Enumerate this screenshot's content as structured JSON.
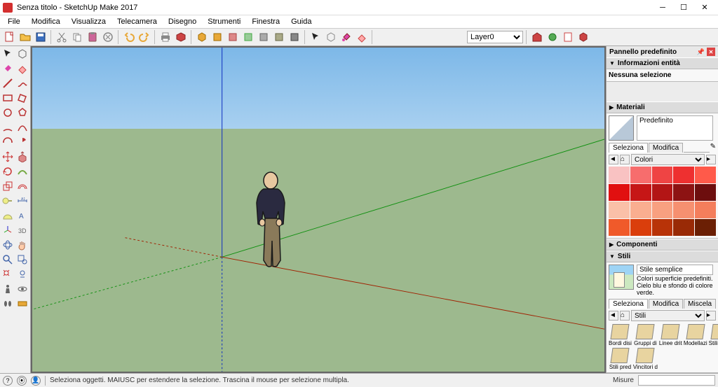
{
  "window": {
    "title": "Senza titolo - SketchUp Make 2017"
  },
  "menu": [
    "File",
    "Modifica",
    "Visualizza",
    "Telecamera",
    "Disegno",
    "Strumenti",
    "Finestra",
    "Guida"
  ],
  "layer": {
    "current": "Layer0"
  },
  "tray": {
    "title": "Pannello predefinito",
    "entity": {
      "header": "Informazioni entità",
      "body": "Nessuna selezione"
    },
    "materials": {
      "header": "Materiali",
      "current_name": "Predefinito",
      "tabs": [
        "Seleziona",
        "Modifica"
      ],
      "library": "Colori",
      "swatches": [
        "#f9c2c2",
        "#f76d6d",
        "#ef4444",
        "#ee3030",
        "#ff5a4a",
        "#e11010",
        "#c61616",
        "#b31515",
        "#8d1313",
        "#6d0e0e",
        "#fac0a8",
        "#faae90",
        "#f8a080",
        "#f69070",
        "#f47e5c",
        "#f05a2a",
        "#da3e0c",
        "#b83308",
        "#992a06",
        "#6b1f04"
      ]
    },
    "components": {
      "header": "Componenti"
    },
    "styles": {
      "header": "Stili",
      "current_name": "Stile semplice",
      "desc": "Colori superficie predefiniti. Cielo blu e sfondo di colore verde.",
      "tabs": [
        "Seleziona",
        "Modifica",
        "Miscela"
      ],
      "library": "Stili",
      "items": [
        "Bordi disi",
        "Gruppi di",
        "Linee drit",
        "Modellazi",
        "Stili asso",
        "Stili pred",
        "Vincitori d"
      ]
    }
  },
  "status": {
    "hint": "Seleziona oggetti. MAIUSC per estendere la selezione. Trascina il mouse per selezione multipla.",
    "measure_label": "Misure"
  }
}
